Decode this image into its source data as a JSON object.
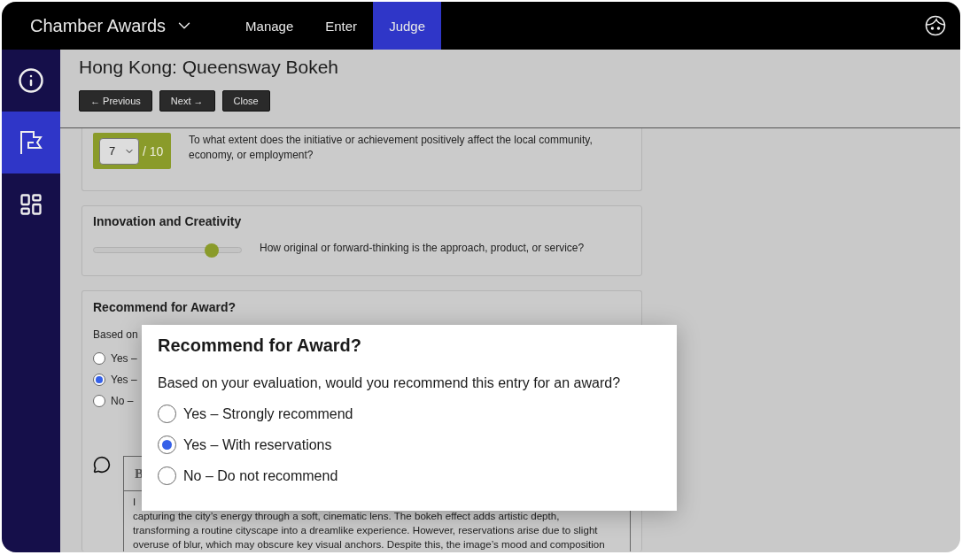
{
  "app": {
    "title": "Chamber Awards",
    "nav": [
      {
        "label": "Manage",
        "selected": false
      },
      {
        "label": "Enter",
        "selected": false
      },
      {
        "label": "Judge",
        "selected": true
      }
    ]
  },
  "sidebar": {
    "items": [
      {
        "kind": "info",
        "selected": false
      },
      {
        "kind": "flag",
        "selected": true
      },
      {
        "kind": "dashboard",
        "selected": false
      }
    ]
  },
  "entry": {
    "title": "Hong Kong: Queensway Bokeh",
    "buttons": [
      "← Previous",
      "Next →",
      "Close"
    ]
  },
  "criteria": [
    {
      "kind": "score",
      "score": "7",
      "max": "/ 10",
      "question": "To what extent does the initiative or achievement positively affect the local community, economy, or employment?"
    },
    {
      "kind": "slider",
      "title": "Innovation and Creativity",
      "level": 0.8,
      "question": "How original or forward-thinking is the approach, product, or service?"
    }
  ],
  "recommend": {
    "title": "Recommend for Award?",
    "prompt": "Based on",
    "options": [
      {
        "label": "Yes –",
        "selected": false
      },
      {
        "label": "Yes –",
        "selected": true
      },
      {
        "label": "No –",
        "selected": false
      }
    ]
  },
  "comment": {
    "toolbar": [
      "B"
    ],
    "lines": [
      "I",
      "capturing the city’s energy through a soft, cinematic lens. The bokeh effect adds artistic depth,",
      "transforming a routine cityscape into a dreamlike experience. However, reservations arise due to slight",
      "overuse of blur, which may obscure key visual anchors. Despite this, the image’s mood and composition"
    ]
  },
  "dialog": {
    "title": "Recommend for Award?",
    "prompt": "Based on your evaluation, would you recommend this entry for an award?",
    "options": [
      {
        "label": "Yes – Strongly recommend",
        "selected": false
      },
      {
        "label": "Yes – With reservations",
        "selected": true
      },
      {
        "label": "No – Do not recommend",
        "selected": false
      }
    ]
  }
}
